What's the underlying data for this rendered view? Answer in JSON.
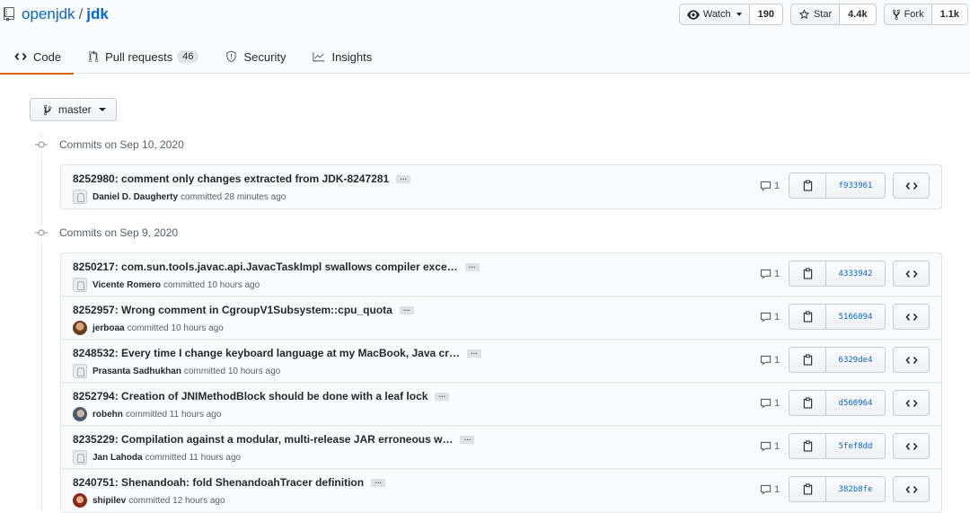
{
  "repo": {
    "owner": "openjdk",
    "separator": "/",
    "name": "jdk"
  },
  "actions": {
    "watch": {
      "label": "Watch",
      "count": "190"
    },
    "star": {
      "label": "Star",
      "count": "4.4k"
    },
    "fork": {
      "label": "Fork",
      "count": "1.1k"
    }
  },
  "tabs": [
    {
      "label": "Code",
      "selected": true
    },
    {
      "label": "Pull requests",
      "counter": "46"
    },
    {
      "label": "Security"
    },
    {
      "label": "Insights"
    }
  ],
  "branch": {
    "label": "master"
  },
  "groups": [
    {
      "date": "Commits on Sep 10, 2020",
      "commits": [
        {
          "title": "8252980: comment only changes extracted from JDK-8247281",
          "author": "Daniel D. Daugherty",
          "action": "committed 28 minutes ago",
          "comments": "1",
          "sha": "f933961",
          "avatar": "default"
        }
      ]
    },
    {
      "date": "Commits on Sep 9, 2020",
      "commits": [
        {
          "title": "8250217: com.sun.tools.javac.api.JavacTaskImpl swallows compiler exce…",
          "author": "Vicente Romero",
          "action": "committed 10 hours ago",
          "comments": "1",
          "sha": "4333942",
          "avatar": "default"
        },
        {
          "title": "8252957: Wrong comment in CgroupV1Subsystem::cpu_quota",
          "author": "jerboaa",
          "action": "committed 10 hours ago",
          "comments": "1",
          "sha": "5166094",
          "avatar": "photo-brown"
        },
        {
          "title": "8248532: Every time I change keyboard language at my MacBook, Java cr…",
          "author": "Prasanta Sadhukhan",
          "action": "committed 10 hours ago",
          "comments": "1",
          "sha": "6329de4",
          "avatar": "default"
        },
        {
          "title": "8252794: Creation of JNIMethodBlock should be done with a leaf lock",
          "author": "robehn",
          "action": "committed 11 hours ago",
          "comments": "1",
          "sha": "d560964",
          "avatar": "photo-gray"
        },
        {
          "title": "8235229: Compilation against a modular, multi-release JAR erroneous w…",
          "author": "Jan Lahoda",
          "action": "committed 11 hours ago",
          "comments": "1",
          "sha": "5fef8dd",
          "avatar": "default"
        },
        {
          "title": "8240751: Shenandoah: fold ShenandoahTracer definition",
          "author": "shipilev",
          "action": "committed 12 hours ago",
          "comments": "1",
          "sha": "382b8fe",
          "avatar": "photo-red"
        }
      ]
    }
  ],
  "colors": {
    "link": "#0366d6",
    "tab_underline": "#e36209",
    "border": "#e1e4e8"
  },
  "icons": {
    "repo": "repo-icon",
    "eye": "eye-icon",
    "star": "star-icon",
    "fork": "repo-forked-icon",
    "code": "code-icon",
    "pr": "git-pull-request-icon",
    "security": "shield-icon",
    "insights": "graph-icon",
    "branch": "git-branch-icon",
    "commit": "git-commit-icon",
    "comment": "comment-icon",
    "clipboard": "clippy-icon",
    "browse": "code-icon"
  }
}
